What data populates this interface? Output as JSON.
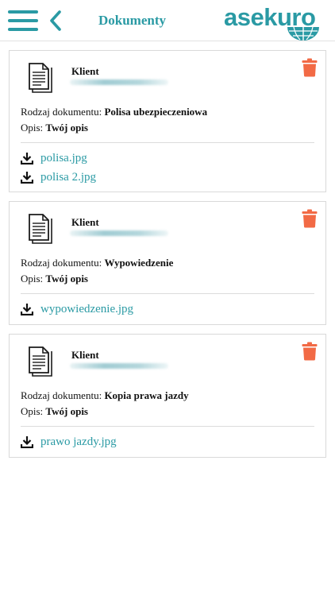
{
  "colors": {
    "accent": "#2a9aa4",
    "delete": "#f26a45",
    "text": "#111111",
    "divider": "#dcdcdc"
  },
  "header": {
    "title": "Dokumenty",
    "logo_text": "asekuro",
    "menu_icon": "hamburger-menu-icon",
    "back_icon": "chevron-left-icon"
  },
  "documents": [
    {
      "client_label": "Klient",
      "type_label": "Rodzaj dokumentu:",
      "type_value": "Polisa ubezpieczeniowa",
      "desc_label": "Opis:",
      "desc_value": "Twój opis",
      "files": [
        "polisa.jpg",
        "polisa 2.jpg"
      ]
    },
    {
      "client_label": "Klient",
      "type_label": "Rodzaj dokumentu:",
      "type_value": "Wypowiedzenie",
      "desc_label": "Opis:",
      "desc_value": "Twój opis",
      "files": [
        "wypowiedzenie.jpg"
      ]
    },
    {
      "client_label": "Klient",
      "type_label": "Rodzaj dokumentu:",
      "type_value": "Kopia prawa jazdy",
      "desc_label": "Opis:",
      "desc_value": "Twój opis",
      "files": [
        "prawo jazdy.jpg"
      ]
    }
  ]
}
